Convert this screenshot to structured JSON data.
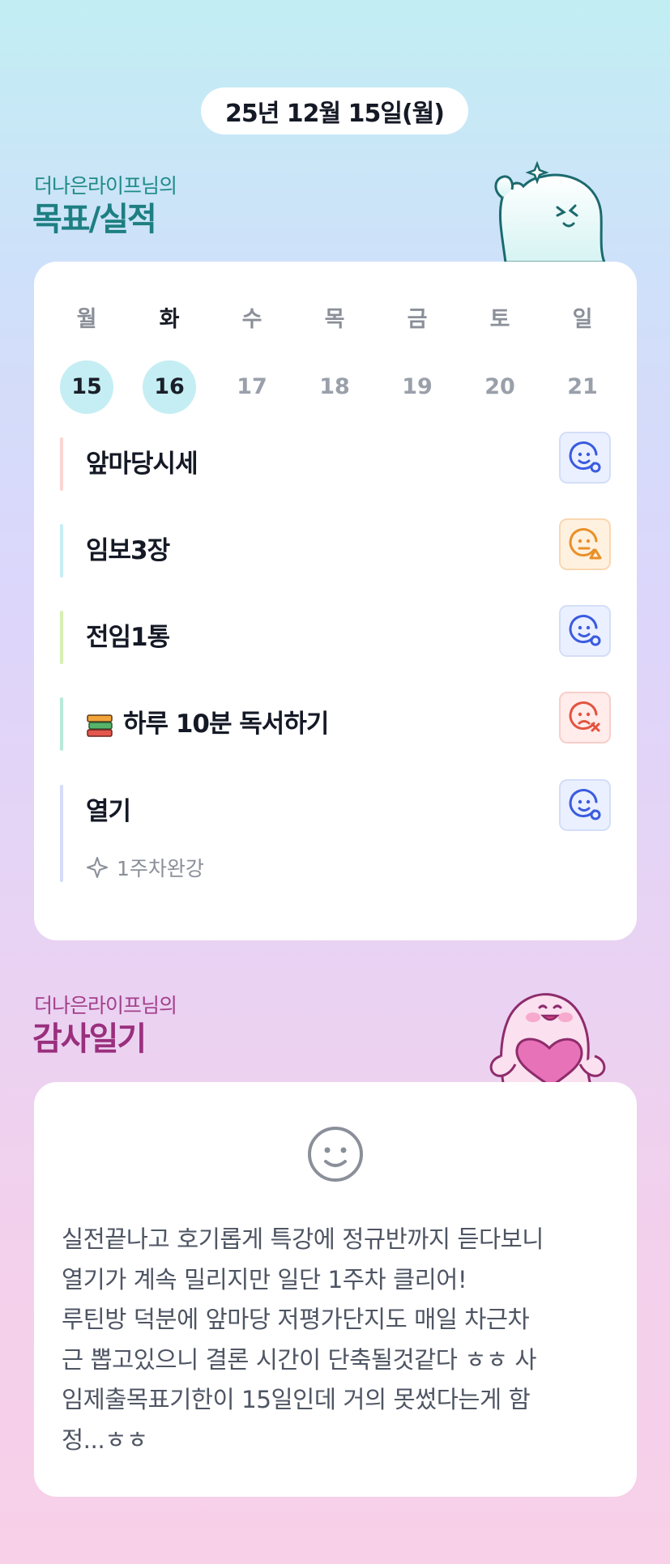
{
  "header": {
    "date": "25년 12월 15일(월)"
  },
  "goals_section": {
    "subtitle": "더나은라이프님의",
    "title": "목표/실적",
    "week": [
      {
        "dow": "월",
        "num": "15",
        "active": true,
        "today": false
      },
      {
        "dow": "화",
        "num": "16",
        "active": true,
        "today": true
      },
      {
        "dow": "수",
        "num": "17",
        "active": false,
        "today": false
      },
      {
        "dow": "목",
        "num": "18",
        "active": false,
        "today": false
      },
      {
        "dow": "금",
        "num": "19",
        "active": false,
        "today": false
      },
      {
        "dow": "토",
        "num": "20",
        "active": false,
        "today": false
      },
      {
        "dow": "일",
        "num": "21",
        "active": false,
        "today": false
      }
    ],
    "goals": [
      {
        "label": "앞마당시세",
        "bar_color": "#fbd5d3",
        "status": "done",
        "status_icon": "smile-check-icon"
      },
      {
        "label": "임보3장",
        "bar_color": "#c6eef4",
        "status": "partial",
        "status_icon": "smile-triangle-icon"
      },
      {
        "label": "전임1통",
        "bar_color": "#d7efb3",
        "status": "done",
        "status_icon": "smile-check-icon"
      },
      {
        "label": "하루 10분 독서하기",
        "bar_color": "#b8ead9",
        "status": "fail",
        "status_icon": "sad-x-icon",
        "icon": "books-icon"
      },
      {
        "label": "열기",
        "bar_color": "#d5dcf8",
        "status": "done",
        "status_icon": "smile-check-icon",
        "note": "1주차완강",
        "note_icon": "sparkle-icon"
      }
    ]
  },
  "diary_section": {
    "subtitle": "더나은라이프님의",
    "title": "감사일기",
    "mood_icon": "smile-face-icon",
    "text": "실전끝나고 호기롭게 특강에 정규반까지 듣다보니\n열기가 계속 밀리지만 일단 1주차 클리어!\n루틴방 덕분에 앞마당 저평가단지도 매일 차근차\n근 뽑고있으니 결론 시간이 단축될것같다 ㅎㅎ 사\n임제출목표기한이 15일인데 거의 못썼다는게 함\n정...ㅎㅎ"
  },
  "colors": {
    "blue_badge": "#3b5be0",
    "orange_badge": "#e8902a",
    "red_badge": "#e2543f",
    "goal_title": "#1d7f82",
    "diary_title": "#9a2f7e"
  }
}
